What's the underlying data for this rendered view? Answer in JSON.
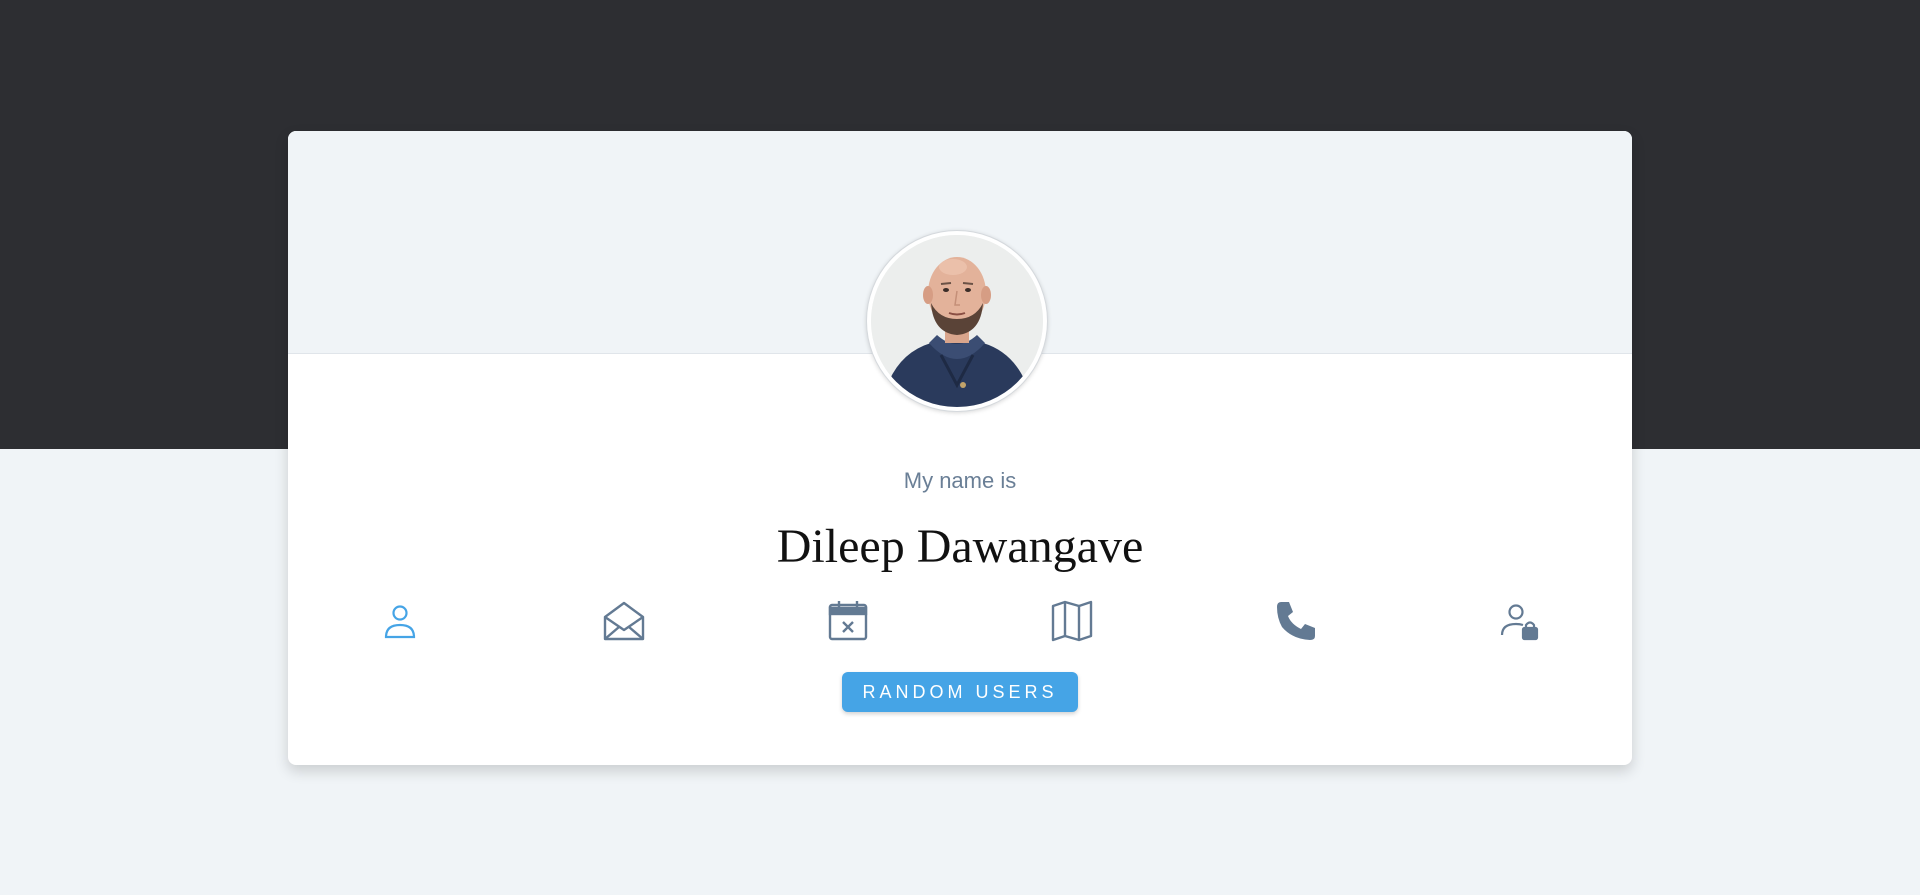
{
  "profile": {
    "label": "My name is",
    "value": "Dileep Dawangave"
  },
  "icons": [
    {
      "name": "user-icon",
      "active": true
    },
    {
      "name": "envelope-open-icon",
      "active": false
    },
    {
      "name": "calendar-x-icon",
      "active": false
    },
    {
      "name": "map-icon",
      "active": false
    },
    {
      "name": "phone-icon",
      "active": false
    },
    {
      "name": "user-lock-icon",
      "active": false
    }
  ],
  "button": {
    "label": "Random Users"
  },
  "colors": {
    "dark_band": "#2d2e32",
    "page_bg": "#f0f4f7",
    "accent": "#45a4e6",
    "icon_inactive": "#637a93",
    "label_text": "#6a7f96"
  }
}
